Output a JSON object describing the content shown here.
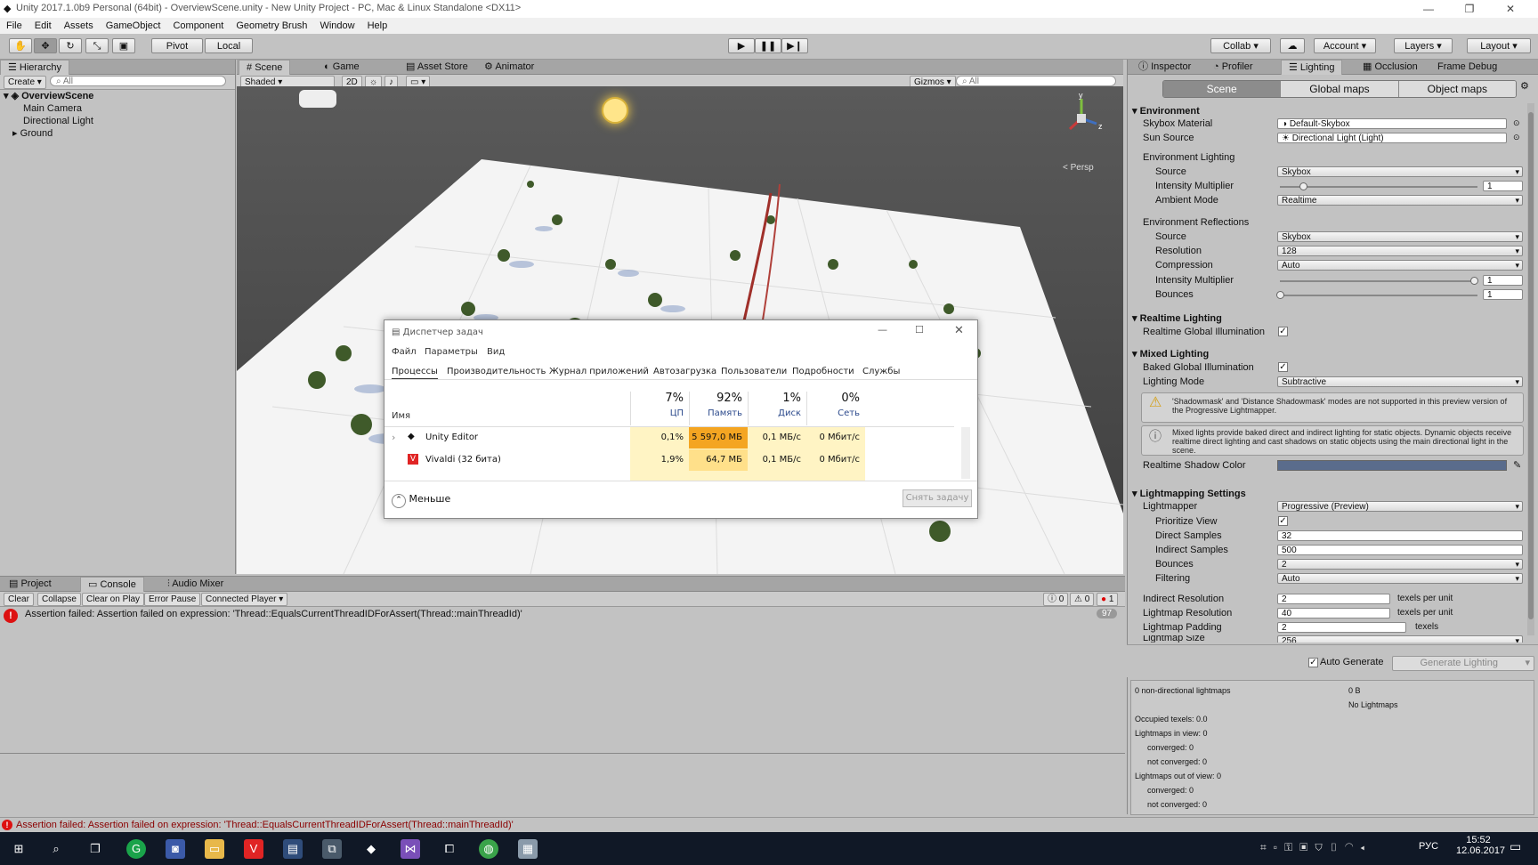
{
  "window": {
    "title": "Unity 2017.1.0b9 Personal (64bit) - OverviewScene.unity - New Unity Project - PC, Mac & Linux Standalone <DX11>"
  },
  "menu": [
    "File",
    "Edit",
    "Assets",
    "GameObject",
    "Component",
    "Geometry Brush",
    "Window",
    "Help"
  ],
  "toolbar": {
    "pivot": "Pivot",
    "local": "Local",
    "collab": "Collab",
    "account": "Account",
    "layers": "Layers",
    "layout": "Layout"
  },
  "hierarchy": {
    "tab": "Hierarchy",
    "create": "Create",
    "search": "All",
    "scene": "OverviewScene",
    "items": [
      "Main Camera",
      "Directional Light",
      "Ground"
    ]
  },
  "scene_tabs": {
    "scene": "Scene",
    "game": "Game",
    "store": "Asset Store",
    "animator": "Animator"
  },
  "scene_toolbar": {
    "shading": "Shaded",
    "mode2d": "2D",
    "gizmos": "Gizmos",
    "search": "All",
    "persp": "Persp"
  },
  "inspector_tabs": {
    "inspector": "Inspector",
    "profiler": "Profiler",
    "lighting": "Lighting",
    "occlusion": "Occlusion",
    "frame_debug": "Frame Debug"
  },
  "lighting": {
    "subtabs": [
      "Scene",
      "Global maps",
      "Object maps"
    ],
    "environment": {
      "header": "Environment",
      "skybox_label": "Skybox Material",
      "skybox_value": "Default-Skybox",
      "sun_label": "Sun Source",
      "sun_value": "Directional Light (Light)",
      "env_lighting": "Environment Lighting",
      "source_label": "Source",
      "source_value": "Skybox",
      "intensity_label": "Intensity Multiplier",
      "intensity_value": "1",
      "ambient_label": "Ambient Mode",
      "ambient_value": "Realtime",
      "env_reflections": "Environment Reflections",
      "refl_source_label": "Source",
      "refl_source_value": "Skybox",
      "resolution_label": "Resolution",
      "resolution_value": "128",
      "compression_label": "Compression",
      "compression_value": "Auto",
      "refl_intensity_label": "Intensity Multiplier",
      "refl_intensity_value": "1",
      "bounces_label": "Bounces",
      "bounces_value": "1"
    },
    "realtime": {
      "header": "Realtime Lighting",
      "rgi_label": "Realtime Global Illumination"
    },
    "mixed": {
      "header": "Mixed Lighting",
      "bgi_label": "Baked Global Illumination",
      "mode_label": "Lighting Mode",
      "mode_value": "Subtractive",
      "warning": "'Shadowmask' and 'Distance Shadowmask' modes are not supported in this preview version of the Progressive Lightmapper.",
      "info": "Mixed lights provide baked direct and indirect lighting for static objects. Dynamic objects receive realtime direct lighting and cast shadows on static objects using the main directional light in the scene.",
      "shadow_color_label": "Realtime Shadow Color",
      "shadow_color": "#5a6c8c"
    },
    "lightmapping": {
      "header": "Lightmapping Settings",
      "lightmapper_label": "Lightmapper",
      "lightmapper_value": "Progressive (Preview)",
      "prioritize_label": "Prioritize View",
      "direct_label": "Direct Samples",
      "direct_value": "32",
      "indirect_label": "Indirect Samples",
      "indirect_value": "500",
      "bounces_label": "Bounces",
      "bounces_value": "2",
      "filtering_label": "Filtering",
      "filtering_value": "Auto",
      "indirect_res_label": "Indirect Resolution",
      "indirect_res_value": "2",
      "indirect_res_unit": "texels per unit",
      "lm_res_label": "Lightmap Resolution",
      "lm_res_value": "40",
      "lm_res_unit": "texels per unit",
      "padding_label": "Lightmap Padding",
      "padding_value": "2",
      "padding_unit": "texels",
      "size_label": "Lightmap Size",
      "size_value": "256"
    },
    "auto_generate": "Auto Generate",
    "generate_button": "Generate Lighting",
    "stats": {
      "nondir": "0 non-directional lightmaps",
      "size": "0 B",
      "nolm": "No Lightmaps",
      "occupied": "Occupied texels: 0.0",
      "in_view": "Lightmaps in view: 0",
      "in_conv": "converged: 0",
      "in_notconv": "not converged: 0",
      "out_view": "Lightmaps out of view: 0",
      "out_conv": "converged: 0",
      "out_notconv": "not converged: 0"
    }
  },
  "console": {
    "tabs": {
      "project": "Project",
      "console": "Console",
      "audio": "Audio Mixer"
    },
    "buttons": [
      "Clear",
      "Collapse",
      "Clear on Play",
      "Error Pause",
      "Connected Player"
    ],
    "counts": {
      "info": "0",
      "warn": "0",
      "error": "1"
    },
    "message": "Assertion failed: Assertion failed on expression: 'Thread::EqualsCurrentThreadIDForAssert(Thread::mainThreadId)'",
    "message_count": "97",
    "status": "Assertion failed: Assertion failed on expression: 'Thread::EqualsCurrentThreadIDForAssert(Thread::mainThreadId)'"
  },
  "task_manager": {
    "title": "Диспетчер задач",
    "menu": [
      "Файл",
      "Параметры",
      "Вид"
    ],
    "tabs": [
      "Процессы",
      "Производительность",
      "Журнал приложений",
      "Автозагрузка",
      "Пользователи",
      "Подробности",
      "Службы"
    ],
    "name_header": "Имя",
    "columns": [
      {
        "pct": "7%",
        "label": "ЦП"
      },
      {
        "pct": "92%",
        "label": "Память"
      },
      {
        "pct": "1%",
        "label": "Диск"
      },
      {
        "pct": "0%",
        "label": "Сеть"
      }
    ],
    "rows": [
      {
        "name": "Unity Editor",
        "cpu": "0,1%",
        "mem": "5 597,0 МБ",
        "disk": "0,1 МБ/с",
        "net": "0 Мбит/с"
      },
      {
        "name": "Vivaldi (32 бита)",
        "cpu": "1,9%",
        "mem": "64,7 МБ",
        "disk": "0,1 МБ/с",
        "net": "0 Мбит/с"
      }
    ],
    "fewer": "Меньше",
    "end_task": "Снять задачу"
  },
  "taskbar": {
    "lang": "РУС",
    "time": "15:52",
    "date": "12.06.2017"
  }
}
